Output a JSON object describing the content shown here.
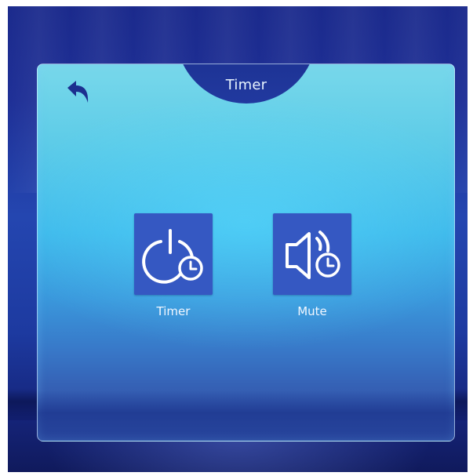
{
  "header": {
    "title": "Timer"
  },
  "tiles": [
    {
      "label": "Timer",
      "icon": "power-timer-icon"
    },
    {
      "label": "Mute",
      "icon": "speaker-timer-icon"
    }
  ],
  "colors": {
    "background": "#1e2f96",
    "panel_top": "#78d8ea",
    "panel_bottom": "#2d4aa0",
    "tile": "#3558c2",
    "text": "#f2f7ff"
  }
}
